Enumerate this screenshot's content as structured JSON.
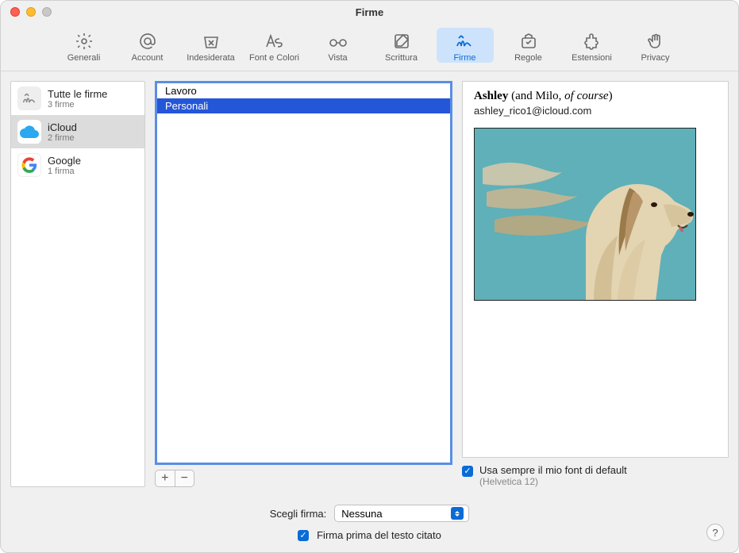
{
  "window": {
    "title": "Firme"
  },
  "toolbar": {
    "items": [
      {
        "label": "Generali"
      },
      {
        "label": "Account"
      },
      {
        "label": "Indesiderata"
      },
      {
        "label": "Font e Colori"
      },
      {
        "label": "Vista"
      },
      {
        "label": "Scrittura"
      },
      {
        "label": "Firme"
      },
      {
        "label": "Regole"
      },
      {
        "label": "Estensioni"
      },
      {
        "label": "Privacy"
      }
    ]
  },
  "sidebar": {
    "items": [
      {
        "label": "Tutte le firme",
        "sub": "3 firme"
      },
      {
        "label": "iCloud",
        "sub": "2 firme"
      },
      {
        "label": "Google",
        "sub": "1 firma"
      }
    ]
  },
  "signatures": {
    "items": [
      {
        "name": "Lavoro"
      },
      {
        "name": "Personali"
      }
    ]
  },
  "preview": {
    "name_bold": "Ashley",
    "name_paren_pre": " (and Milo, ",
    "name_ital": "of course",
    "name_paren_post": ")",
    "email": "ashley_rico1@icloud.com"
  },
  "defaultFont": {
    "label": "Usa sempre il mio font di default",
    "sub": "(Helvetica 12)"
  },
  "bottom": {
    "select_label": "Scegli firma:",
    "select_value": "Nessuna",
    "checkbox_label": "Firma prima del testo citato"
  }
}
